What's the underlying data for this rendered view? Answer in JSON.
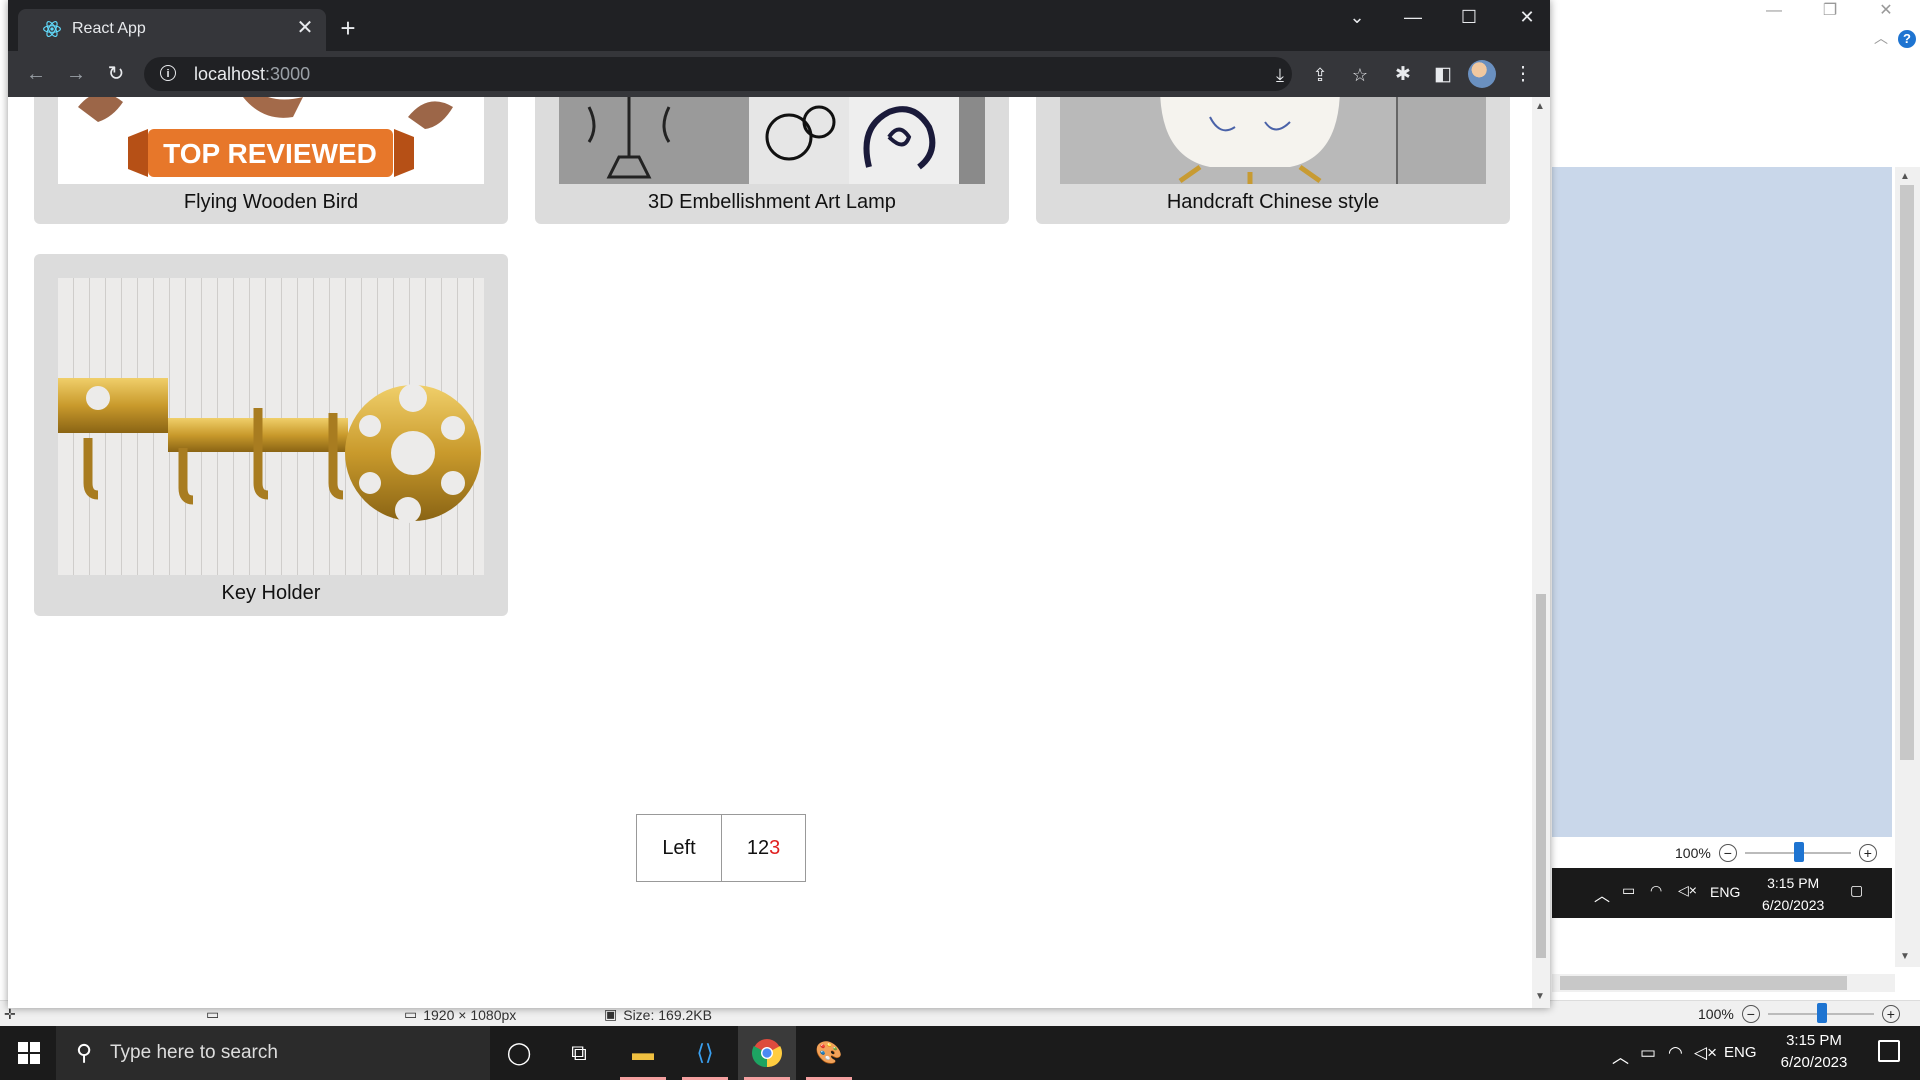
{
  "background_app": {
    "statusbar": {
      "dimensions": "1920 × 1080px",
      "size": "Size: 169.2KB",
      "zoom": "100%"
    },
    "canvas_zoom": "100%",
    "mini_tray": {
      "lang": "ENG",
      "time": "3:15 PM",
      "date": "6/20/2023"
    },
    "help_label": "?"
  },
  "browser": {
    "tab_title": "React App",
    "url_host": "localhost",
    "url_port": ":3000",
    "new_tab_label": "+",
    "tab_close_label": "✕"
  },
  "page": {
    "products": [
      {
        "name": "Flying Wooden Bird",
        "badge": "TOP REVIEWED"
      },
      {
        "name": "3D Embellishment Art Lamp"
      },
      {
        "name": "Handcraft Chinese style"
      },
      {
        "name": "Key Holder"
      }
    ],
    "pagination": {
      "left_label": "Left",
      "pages": [
        "1",
        "2",
        "3"
      ],
      "active_page": "3"
    }
  },
  "taskbar": {
    "search_placeholder": "Type here to search",
    "lang": "ENG",
    "time": "3:15 PM",
    "date": "6/20/2023"
  }
}
